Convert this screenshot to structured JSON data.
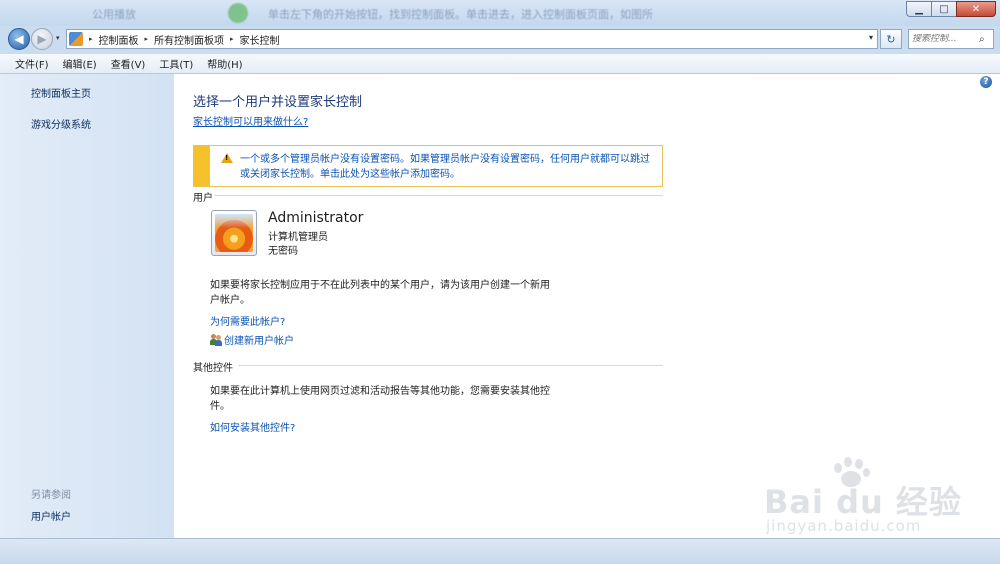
{
  "window": {
    "blurred_title_left": "公用播放",
    "blurred_title_right": "单击左下角的开始按钮，找到控制面板。单击进去，进入控制面板页面，如图所",
    "controls": {
      "minimize": "▁",
      "maximize": "□",
      "close": "✕"
    }
  },
  "address_bar": {
    "breadcrumbs": [
      "控制面板",
      "所有控制面板项",
      "家长控制"
    ],
    "search_placeholder": "搜索控制..."
  },
  "menu": [
    "文件(F)",
    "编辑(E)",
    "查看(V)",
    "工具(T)",
    "帮助(H)"
  ],
  "left_pane": {
    "links": [
      "控制面板主页",
      "游戏分级系统"
    ],
    "see_also_label": "另请参阅",
    "see_also_links": [
      "用户帐户"
    ]
  },
  "main": {
    "title": "选择一个用户并设置家长控制",
    "what_link": "家长控制可以用来做什么?",
    "warning": "一个或多个管理员帐户没有设置密码。如果管理员帐户没有设置密码，任何用户就都可以跳过或关闭家长控制。单击此处为这些帐户添加密码。",
    "users_section": "用户",
    "user": {
      "name": "Administrator",
      "role": "计算机管理员",
      "password_status": "无密码"
    },
    "create_hint": "如果要将家长控制应用于不在此列表中的某个用户，请为该用户创建一个新用户帐户。",
    "why_link": "为何需要此帐户?",
    "create_link": "创建新用户帐户",
    "other_section": "其他控件",
    "other_hint": "如果要在此计算机上使用网页过滤和活动报告等其他功能，您需要安装其他控件。",
    "install_link": "如何安装其他控件?"
  },
  "watermark": {
    "brand": "Bai du 经验",
    "url": "jingyan.baidu.com"
  },
  "icons": {
    "help": "?",
    "search": "⌕",
    "refresh": "↻",
    "dropdown": "▾",
    "breadcrumb_separator": "▸"
  }
}
